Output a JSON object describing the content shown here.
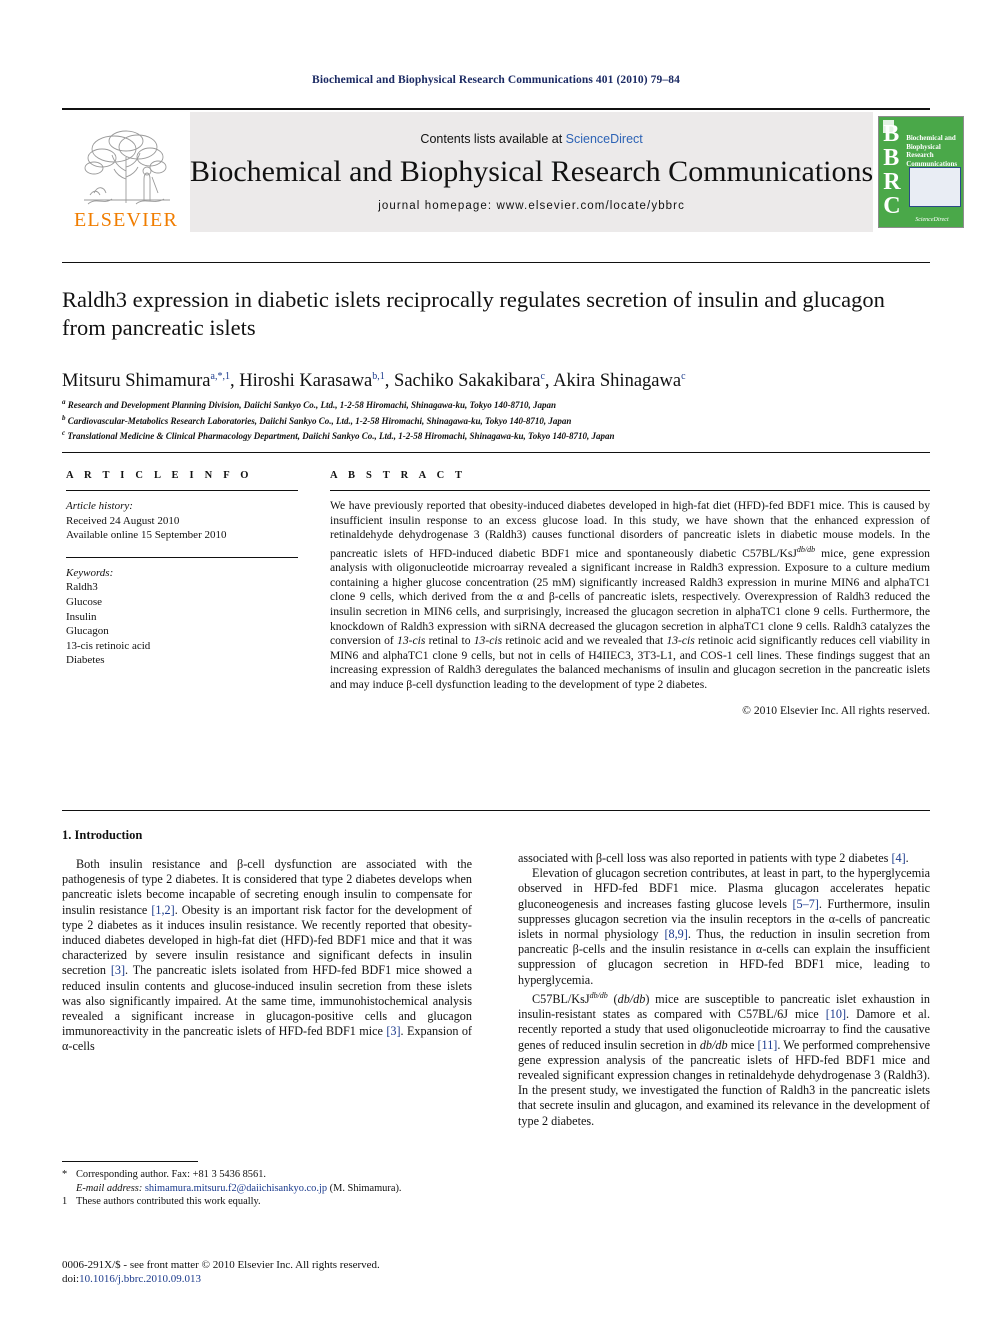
{
  "running_head": "Biochemical and Biophysical Research Communications 401 (2010) 79–84",
  "masthead": {
    "publisher_logo_text": "ELSEVIER",
    "contents_prefix": "Contents lists available at ",
    "contents_link": "ScienceDirect",
    "journal_title": "Biochemical and Biophysical Research Communications",
    "homepage": "journal homepage: www.elsevier.com/locate/ybbrc",
    "cover": {
      "acronym": "BBRC",
      "title": "Biochemical and Biophysical Research Communications",
      "logo": "ScienceDirect",
      "bg_color": "#4aa849"
    }
  },
  "article": {
    "title": "Raldh3 expression in diabetic islets reciprocally regulates secretion of insulin and glucagon from pancreatic islets",
    "authors": [
      {
        "name": "Mitsuru Shimamura",
        "marks": "a,*,1"
      },
      {
        "name": "Hiroshi Karasawa",
        "marks": "b,1"
      },
      {
        "name": "Sachiko Sakakibara",
        "marks": "c"
      },
      {
        "name": "Akira Shinagawa",
        "marks": "c"
      }
    ],
    "affiliations": [
      {
        "mark": "a",
        "text": "Research and Development Planning Division, Daiichi Sankyo Co., Ltd., 1-2-58 Hiromachi, Shinagawa-ku, Tokyo 140-8710, Japan"
      },
      {
        "mark": "b",
        "text": "Cardiovascular-Metabolics Research Laboratories, Daiichi Sankyo Co., Ltd., 1-2-58 Hiromachi, Shinagawa-ku, Tokyo 140-8710, Japan"
      },
      {
        "mark": "c",
        "text": "Translational Medicine & Clinical Pharmacology Department, Daiichi Sankyo Co., Ltd., 1-2-58 Hiromachi, Shinagawa-ku, Tokyo 140-8710, Japan"
      }
    ]
  },
  "article_info": {
    "heading": "A R T I C L E   I N F O",
    "history_label": "Article history:",
    "history": [
      "Received 24 August 2010",
      "Available online 15 September 2010"
    ],
    "keywords_label": "Keywords:",
    "keywords": [
      "Raldh3",
      "Glucose",
      "Insulin",
      "Glucagon",
      "13-cis retinoic acid",
      "Diabetes"
    ]
  },
  "abstract": {
    "heading": "A B S T R A C T",
    "paragraph": "We have previously reported that obesity-induced diabetes developed in high-fat diet (HFD)-fed BDF1 mice. This is caused by insufficient insulin response to an excess glucose load. In this study, we have shown that the enhanced expression of retinaldehyde dehydrogenase 3 (Raldh3) causes functional disorders of pancreatic islets in diabetic mouse models. In the pancreatic islets of HFD-induced diabetic BDF1 mice and spontaneously diabetic C57BL/KsJ@@db/db@@ mice, gene expression analysis with oligonucleotide microarray revealed a significant increase in Raldh3 expression. Exposure to a culture medium containing a higher glucose concentration (25 mM) significantly increased Raldh3 expression in murine MIN6 and alphaTC1 clone 9 cells, which derived from the α and β-cells of pancreatic islets, respectively. Overexpression of Raldh3 reduced the insulin secretion in MIN6 cells, and surprisingly, increased the glucagon secretion in alphaTC1 clone 9 cells. Furthermore, the knockdown of Raldh3 expression with siRNA decreased the glucagon secretion in alphaTC1 clone 9 cells. Raldh3 catalyzes the conversion of 13-cis retinal to 13-cis retinoic acid and we revealed that 13-cis retinoic acid significantly reduces cell viability in MIN6 and alphaTC1 clone 9 cells, but not in cells of H4IIEC3, 3T3-L1, and COS-1 cell lines. These findings suggest that an increasing expression of Raldh3 deregulates the balanced mechanisms of insulin and glucagon secretion in the pancreatic islets and may induce β-cell dysfunction leading to the development of type 2 diabetes.",
    "copyright": "© 2010 Elsevier Inc. All rights reserved."
  },
  "introduction": {
    "heading": "1. Introduction",
    "left_paragraphs": [
      "Both insulin resistance and β-cell dysfunction are associated with the pathogenesis of type 2 diabetes. It is considered that type 2 diabetes develops when pancreatic islets become incapable of secreting enough insulin to compensate for insulin resistance [1,2]. Obesity is an important risk factor for the development of type 2 diabetes as it induces insulin resistance. We recently reported that obesity-induced diabetes developed in high-fat diet (HFD)-fed BDF1 mice and that it was characterized by severe insulin resistance and significant defects in insulin secretion [3]. The pancreatic islets isolated from HFD-fed BDF1 mice showed a reduced insulin contents and glucose-induced insulin secretion from these islets was also significantly impaired. At the same time, immunohistochemical analysis revealed a significant increase in glucagon-positive cells and glucagon immunoreactivity in the pancreatic islets of HFD-fed BDF1 mice [3]. Expansion of α-cells"
    ],
    "right_paragraphs": [
      "associated with β-cell loss was also reported in patients with type 2 diabetes [4].",
      "Elevation of glucagon secretion contributes, at least in part, to the hyperglycemia observed in HFD-fed BDF1 mice. Plasma glucagon accelerates hepatic gluconeogenesis and increases fasting glucose levels [5–7]. Furthermore, insulin suppresses glucagon secretion via the insulin receptors in the α-cells of pancreatic islets in normal physiology [8,9]. Thus, the reduction in insulin secretion from pancreatic β-cells and the insulin resistance in α-cells can explain the insufficient suppression of glucagon secretion in HFD-fed BDF1 mice, leading to hyperglycemia.",
      "C57BL/KsJ@@db/db@@ (db/db) mice are susceptible to pancreatic islet exhaustion in insulin-resistant states as compared with C57BL/6J mice [10]. Damore et al. recently reported a study that used oligonucleotide microarray to find the causative genes of reduced insulin secretion in db/db mice [11]. We performed comprehensive gene expression analysis of the pancreatic islets of HFD-fed BDF1 mice and revealed significant expression changes in retinaldehyde dehydrogenase 3 (Raldh3). In the present study, we investigated the function of Raldh3 in the pancreatic islets that secrete insulin and glucagon, and examined its relevance in the development of type 2 diabetes."
    ]
  },
  "footnotes": {
    "corresponding": "Corresponding author. Fax: +81 3 5436 8561.",
    "corresponding_mark": "*",
    "email_label": "E-mail address:",
    "email": "shimamura.mitsuru.f2@daiichisankyo.co.jp",
    "email_suffix": "(M. Shimamura).",
    "equal_mark": "1",
    "equal_contribution": "These authors contributed this work equally."
  },
  "imprint": {
    "issn_line": "0006-291X/$ - see front matter © 2010 Elsevier Inc. All rights reserved.",
    "doi_label": "doi:",
    "doi": "10.1016/j.bbrc.2010.09.013"
  },
  "colors": {
    "link_blue": "#1b3a8c",
    "sciencedirect_blue": "#2d63b5",
    "elsevier_orange": "#f07d00",
    "cover_green": "#4aa849",
    "runhead_navy": "#1b2a63"
  }
}
